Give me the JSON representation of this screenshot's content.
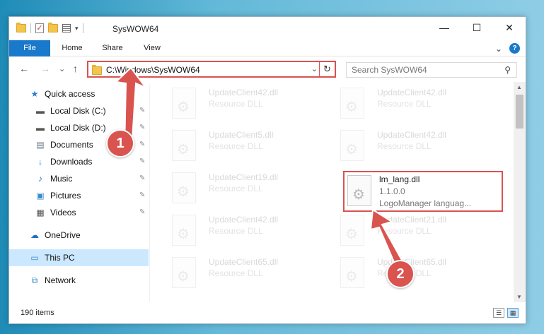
{
  "window": {
    "title": "SysWOW64",
    "controls": {
      "minimize": "—",
      "maximize": "☐",
      "close": "✕"
    }
  },
  "ribbon": {
    "tabs": [
      {
        "label": "File"
      },
      {
        "label": "Home"
      },
      {
        "label": "Share"
      },
      {
        "label": "View"
      }
    ],
    "expand_glyph": "⌄",
    "help_glyph": "?"
  },
  "navigation": {
    "back_glyph": "←",
    "forward_glyph": "→",
    "recent_glyph": "⌄",
    "up_glyph": "↑",
    "address_path": "C:\\Windows\\SysWOW64",
    "dropdown_glyph": "⌄",
    "refresh_glyph": "↻",
    "search_placeholder": "Search SysWOW64",
    "search_glyph": "⚲"
  },
  "sidebar": {
    "items": [
      {
        "label": "Quick access",
        "icon": "star-icon"
      },
      {
        "label": "Local Disk (C:)",
        "icon": "drive-icon",
        "pinned": true
      },
      {
        "label": "Local Disk (D:)",
        "icon": "drive-icon",
        "pinned": true
      },
      {
        "label": "Documents",
        "icon": "documents-icon",
        "pinned": true
      },
      {
        "label": "Downloads",
        "icon": "downloads-icon",
        "pinned": true
      },
      {
        "label": "Music",
        "icon": "music-icon",
        "pinned": true
      },
      {
        "label": "Pictures",
        "icon": "pictures-icon",
        "pinned": true
      },
      {
        "label": "Videos",
        "icon": "videos-icon",
        "pinned": true
      },
      {
        "label": "OneDrive",
        "icon": "onedrive-icon"
      },
      {
        "label": "This PC",
        "icon": "this-pc-icon",
        "selected": true
      },
      {
        "label": "Network",
        "icon": "network-icon"
      }
    ],
    "pin_glyph": "📌"
  },
  "files": [
    {
      "name": "UpdateClient42.dll",
      "description": "Resource DLL"
    },
    {
      "name": "UpdateClient42.dll",
      "description": "Resource DLL"
    },
    {
      "name": "UpdateClient5.dll",
      "description": "Resource DLL"
    },
    {
      "name": "UpdateClient42.dll",
      "description": "Resource DLL"
    },
    {
      "name": "UpdateClient19.dll",
      "description": "Resource DLL"
    },
    {
      "name": "lm_lang.dll",
      "version": "1.1.0.0",
      "description": "LogoManager languag...",
      "highlighted": true
    },
    {
      "name": "UpdateClient42.dll",
      "description": "Resource DLL"
    },
    {
      "name": "UpdateClient21.dll",
      "description": "Resource DLL"
    },
    {
      "name": "UpdateClient65.dll",
      "description": "Resource DLL"
    },
    {
      "name": "UpdateClient65.dll",
      "description": "Resource DLL"
    }
  ],
  "status": {
    "item_count": "190 items"
  },
  "annotations": {
    "callout_1": "1",
    "callout_2": "2",
    "color": "#d9534f"
  },
  "colors": {
    "accent": "#1979ca",
    "selection": "#cce8ff",
    "highlight_border": "#d9534f"
  }
}
